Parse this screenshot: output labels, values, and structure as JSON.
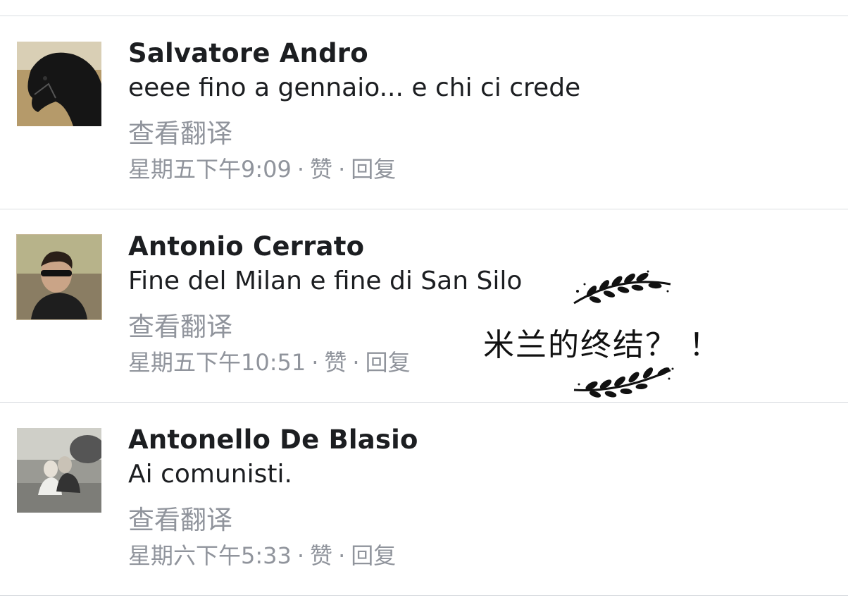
{
  "translate_label": "查看翻译",
  "like_label": "赞",
  "reply_label": "回复",
  "separator": "·",
  "comments": [
    {
      "author": "Salvatore Andro",
      "text": "eeee fino a gennaio... e chi ci crede",
      "timestamp": "星期五下午9:09"
    },
    {
      "author": "Antonio Cerrato",
      "text": "Fine del Milan e fine di San Silo",
      "timestamp": "星期五下午10:51"
    },
    {
      "author": "Antonello De Blasio",
      "text": "Ai comunisti.",
      "timestamp": "星期六下午5:33"
    }
  ],
  "annotation": {
    "text": "米兰的终结？ ！"
  },
  "colors": {
    "name": "#1c1e21",
    "secondary": "#90949c",
    "divider": "#dadde1"
  }
}
